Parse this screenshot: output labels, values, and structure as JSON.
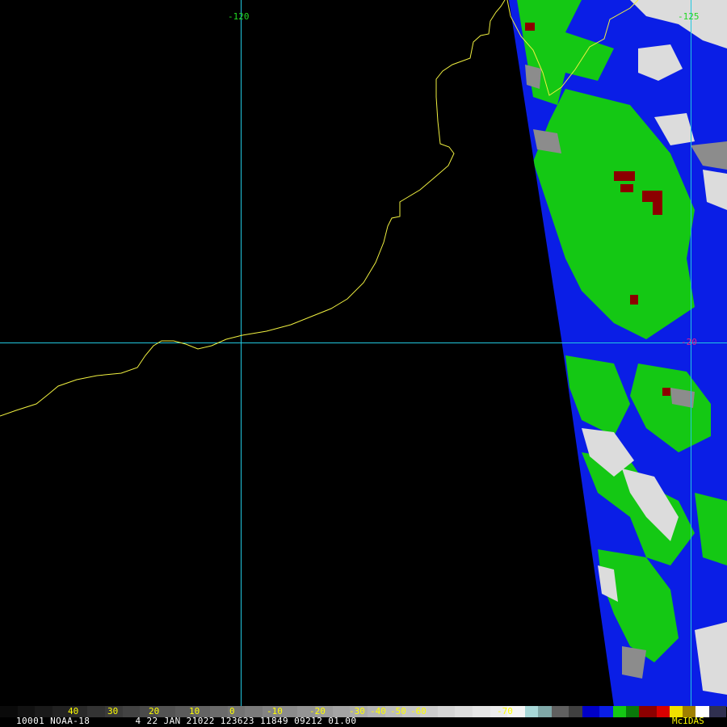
{
  "map": {
    "longitude_labels": [
      {
        "text": "-120",
        "color": "#22d822"
      },
      {
        "text": "-125",
        "color": "#22d822"
      }
    ],
    "latitude_labels": [
      {
        "text": "-20",
        "color": "#e0208a"
      }
    ],
    "graticule_color": "#22c8e0",
    "coastline_color": "#f0f040",
    "background_color": "#000000",
    "imagery_colors": {
      "clear": "#0a1ee6",
      "low_cloud": "#14c814",
      "high_cloud": "#dcdcdc",
      "mid_gray": "#8c8c8c",
      "deep_cloud": "#8c0000"
    }
  },
  "colorbar": {
    "labels": [
      "40",
      "30",
      "20",
      "10",
      "0",
      "-10",
      "-20",
      "-30",
      "-40",
      "-50",
      "-60",
      "-70"
    ],
    "label_colors": [
      "#ffff00",
      "#ffff00",
      "#ffff00",
      "#ffff00",
      "#ffff00",
      "#ffff00",
      "#ffff00",
      "#ffff00",
      "#ffff00",
      "#ffff00",
      "#ffff00",
      "#ffff00"
    ]
  },
  "footer": {
    "info_line": "10001 NOAA-18        4 22 JAN 21022 123623 11849 09212 01.00",
    "brand": "McIDAS"
  }
}
